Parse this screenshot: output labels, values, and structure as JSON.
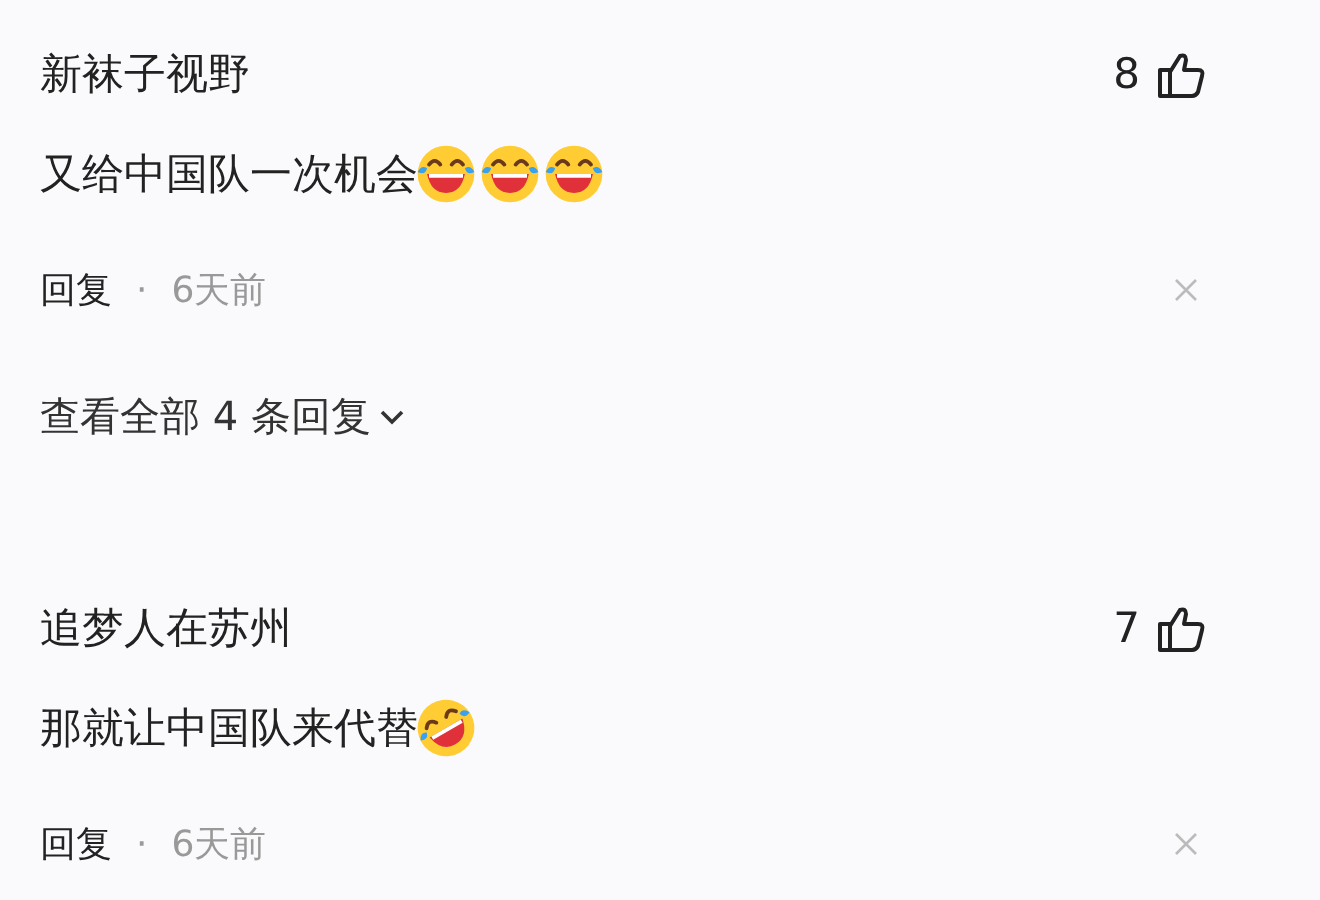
{
  "comments": [
    {
      "author": "新袜子视野",
      "likes": "8",
      "text": "又给中国队一次机会",
      "emojis": [
        {
          "kind": "laughing"
        },
        {
          "kind": "laughing"
        },
        {
          "kind": "laughing"
        }
      ],
      "reply": "回复",
      "separator": "·",
      "time": "6天前",
      "view_replies": "查看全部 4 条回复"
    },
    {
      "author": "追梦人在苏州",
      "likes": "7",
      "text": "那就让中国队来代替",
      "emojis": [
        {
          "kind": "rolling"
        }
      ],
      "reply": "回复",
      "separator": "·",
      "time": "6天前"
    }
  ]
}
